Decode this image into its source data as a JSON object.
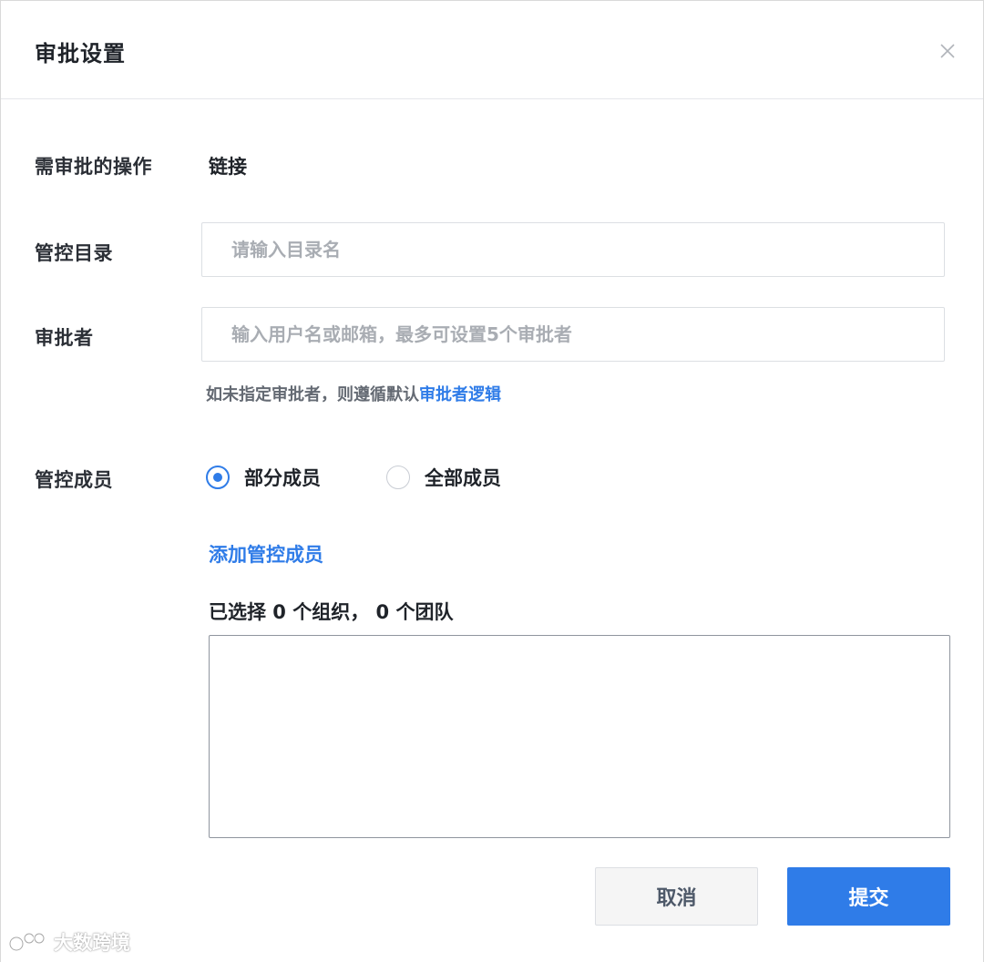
{
  "dialog": {
    "title": "审批设置"
  },
  "form": {
    "operation": {
      "label": "需审批的操作",
      "value": "链接"
    },
    "directory": {
      "label": "管控目录",
      "placeholder": "请输入目录名",
      "value": ""
    },
    "approver": {
      "label": "审批者",
      "placeholder": "输入用户名或邮箱，最多可设置5个审批者",
      "value": "",
      "hint_text": "如未指定审批者，则遵循默认",
      "hint_link": "审批者逻辑"
    },
    "members": {
      "label": "管控成员",
      "options": [
        {
          "label": "部分成员",
          "checked": true
        },
        {
          "label": "全部成员",
          "checked": false
        }
      ],
      "add_link": "添加管控成员",
      "selected_summary": "已选择 0 个组织， 0 个团队"
    }
  },
  "footer": {
    "cancel_label": "取消",
    "submit_label": "提交"
  },
  "watermark": {
    "text": "大数跨境"
  },
  "colors": {
    "accent": "#2f7ce8",
    "label": "#2b2f36",
    "hint": "#646a73",
    "placeholder": "#a9adb3"
  }
}
